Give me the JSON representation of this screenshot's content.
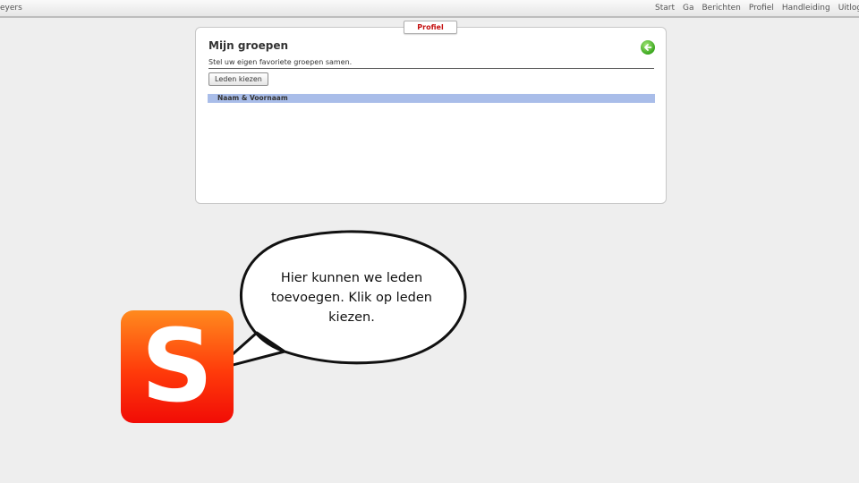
{
  "topbar": {
    "user_fragment": "eyers",
    "nav": [
      "Start",
      "Ga",
      "Berichten",
      "Profiel",
      "Handleiding",
      "Uitloggen"
    ]
  },
  "panel": {
    "tab_label": "Profiel",
    "title": "Mijn groepen",
    "subtitle": "Stel uw eigen favoriete groepen samen.",
    "back_icon": "arrow-left-circle-icon",
    "button_label": "Leden kiezen",
    "table": {
      "columns": [
        "Naam & Voornaam"
      ],
      "rows": []
    }
  },
  "tutorial": {
    "logo_letter": "S",
    "bubble_text": "Hier kunnen we leden toevoegen. Klik op leden kiezen."
  },
  "colors": {
    "tab_text": "#c41010",
    "table_header": "#a9bde9",
    "back_icon": "#3aa61e",
    "logo_top": "#ff8a1e",
    "logo_bottom": "#f10c06"
  }
}
